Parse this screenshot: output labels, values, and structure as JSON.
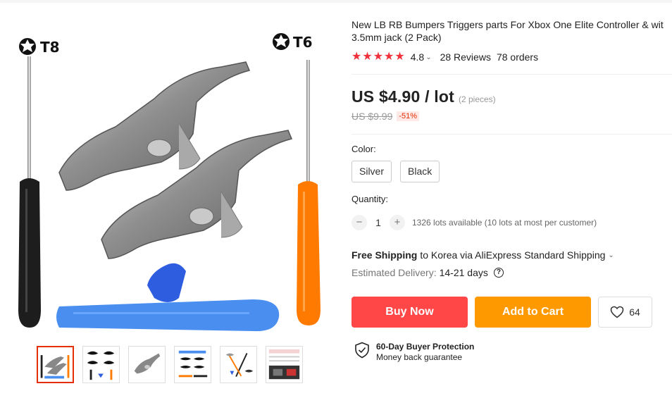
{
  "product": {
    "title_line1": "New LB RB Bumpers Triggers parts For Xbox One Elite Controller & wit",
    "title_line2": "3.5mm jack (2 Pack)",
    "rating": "4.8",
    "stars": 4.8,
    "reviews": "28 Reviews",
    "orders": "78 orders"
  },
  "gallery": {
    "left_tool_label": "T8",
    "right_tool_label": "T6",
    "thumbnail_count": 6,
    "active_thumbnail": 1
  },
  "price": {
    "current": "US $4.90 / lot",
    "pieces": "(2 pieces)",
    "original": "US $9.99",
    "discount": "-51%"
  },
  "color": {
    "label": "Color:",
    "options": [
      "Silver",
      "Black"
    ]
  },
  "quantity": {
    "label": "Quantity:",
    "value": "1",
    "minus": "−",
    "plus": "+",
    "available": "1326 lots available (10 lots at most per customer)"
  },
  "shipping": {
    "free": "Free Shipping",
    "details": "to Korea via AliExpress Standard Shipping",
    "estimated_label": "Estimated Delivery:",
    "estimated_days": "14-21 days",
    "help": "?"
  },
  "actions": {
    "buy_now": "Buy Now",
    "add_to_cart": "Add to Cart",
    "wishlist_count": "64"
  },
  "protection": {
    "title": "60-Day Buyer Protection",
    "subtitle": "Money back guarantee"
  },
  "colors": {
    "buy": "#ff4747",
    "cart": "#ff9900",
    "star": "#f0303a",
    "discount": "#e62e04"
  }
}
